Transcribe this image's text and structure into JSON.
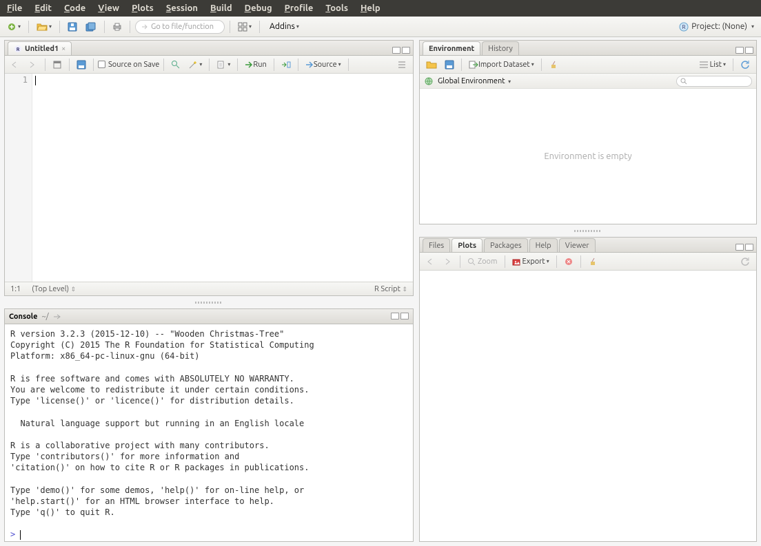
{
  "menubar": [
    "File",
    "Edit",
    "Code",
    "View",
    "Plots",
    "Session",
    "Build",
    "Debug",
    "Profile",
    "Tools",
    "Help"
  ],
  "main_tb": {
    "goto_placeholder": "Go to file/function",
    "addins": "Addins",
    "project_label": "Project: (None)"
  },
  "source": {
    "tab": "Untitled1",
    "save_label": "Source on Save",
    "run": "Run",
    "source_btn": "Source",
    "gutter_1": "1",
    "pos": "1:1",
    "scope": "(Top Level)",
    "lang": "R Script"
  },
  "console": {
    "title": "Console",
    "cwd": "~/",
    "text": "R version 3.2.3 (2015-12-10) -- \"Wooden Christmas-Tree\"\nCopyright (C) 2015 The R Foundation for Statistical Computing\nPlatform: x86_64-pc-linux-gnu (64-bit)\n\nR is free software and comes with ABSOLUTELY NO WARRANTY.\nYou are welcome to redistribute it under certain conditions.\nType 'license()' or 'licence()' for distribution details.\n\n  Natural language support but running in an English locale\n\nR is a collaborative project with many contributors.\nType 'contributors()' for more information and\n'citation()' on how to cite R or R packages in publications.\n\nType 'demo()' for some demos, 'help()' for on-line help, or\n'help.start()' for an HTML browser interface to help.\nType 'q()' to quit R.\n",
    "prompt": ">"
  },
  "env": {
    "tab_env": "Environment",
    "tab_hist": "History",
    "import": "Import Dataset",
    "list": "List",
    "scope": "Global Environment",
    "empty": "Environment is empty"
  },
  "plots": {
    "tab_files": "Files",
    "tab_plots": "Plots",
    "tab_packages": "Packages",
    "tab_help": "Help",
    "tab_viewer": "Viewer",
    "zoom": "Zoom",
    "export": "Export"
  }
}
